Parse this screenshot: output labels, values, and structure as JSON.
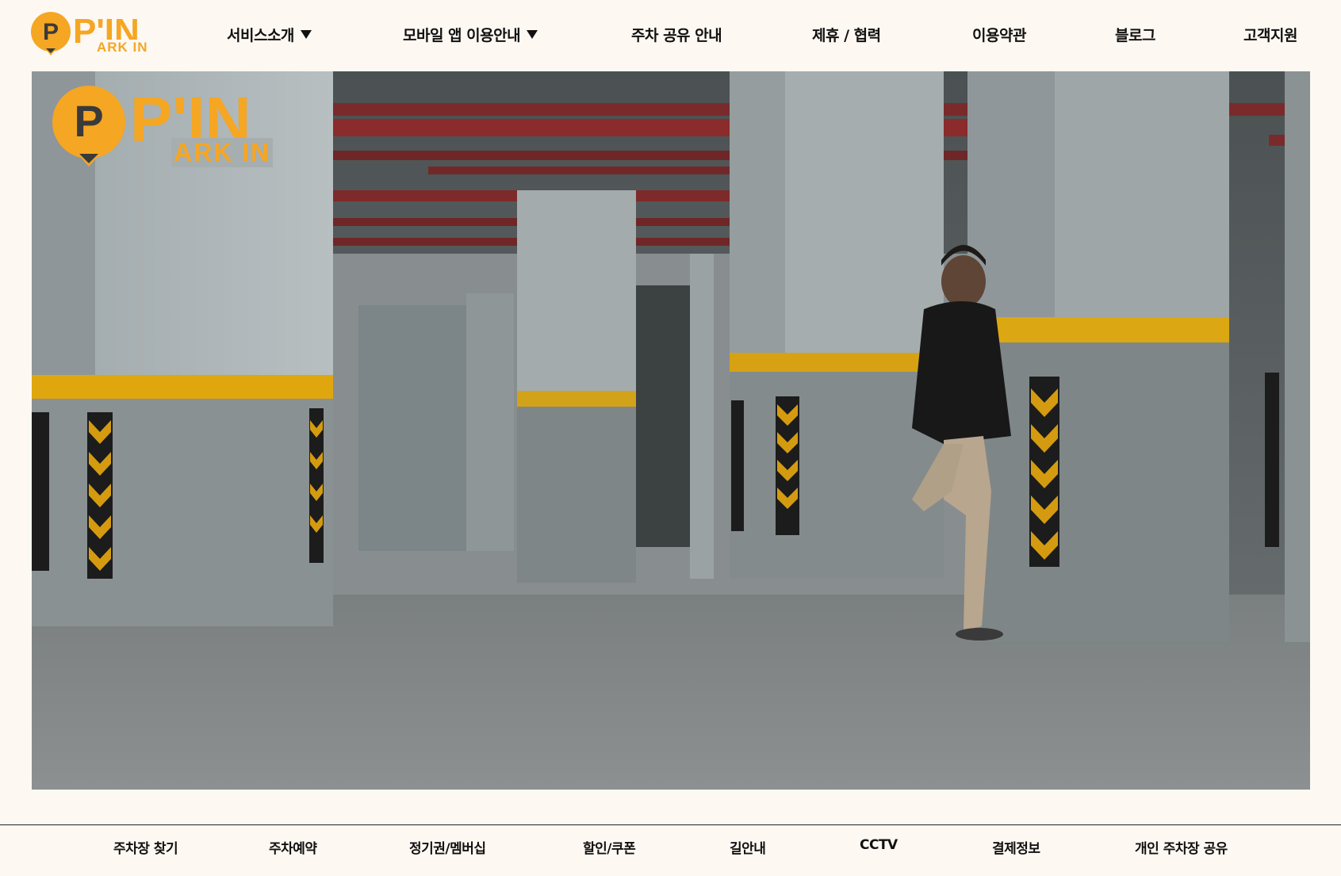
{
  "brand": {
    "logo_letter": "P",
    "logo_title": "P'IN",
    "logo_subtitle": "ARK IN",
    "accent_color": "#f5a623"
  },
  "nav": {
    "items": [
      {
        "label": "서비스소개",
        "has_dropdown": true
      },
      {
        "label": "모바일 앱 이용안내",
        "has_dropdown": true
      },
      {
        "label": "주차 공유 안내",
        "has_dropdown": false
      },
      {
        "label": "제휴 / 협력",
        "has_dropdown": false
      },
      {
        "label": "이용약관",
        "has_dropdown": false
      },
      {
        "label": "블로그",
        "has_dropdown": false
      },
      {
        "label": "고객지원",
        "has_dropdown": false
      }
    ]
  },
  "hero": {
    "icon": "parking-garage-video",
    "logo_letter": "P",
    "logo_title": "P'IN",
    "logo_subtitle": "ARK IN"
  },
  "bottom_nav": {
    "items": [
      {
        "label": "주차장 찾기"
      },
      {
        "label": "주차예약"
      },
      {
        "label": "정기권/멤버십"
      },
      {
        "label": "할인/쿠폰"
      },
      {
        "label": "길안내"
      },
      {
        "label": "CCTV"
      },
      {
        "label": "결제정보"
      },
      {
        "label": "개인 주차장 공유"
      }
    ]
  }
}
